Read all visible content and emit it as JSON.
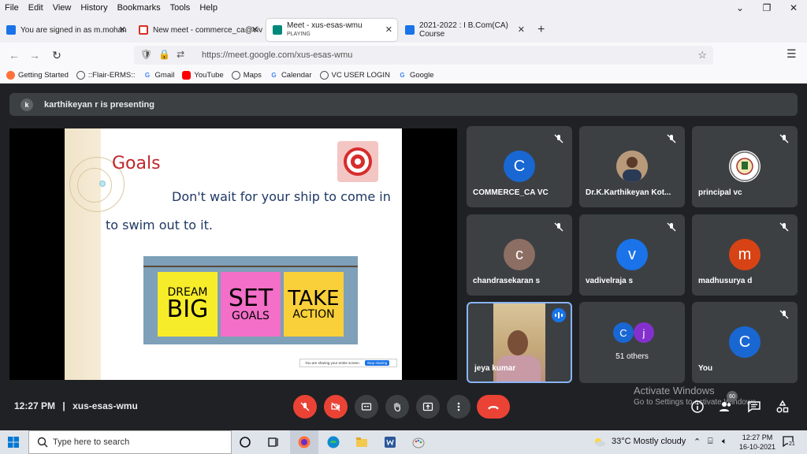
{
  "menubar": {
    "items": [
      "File",
      "Edit",
      "View",
      "History",
      "Bookmarks",
      "Tools",
      "Help"
    ],
    "minimize": "⌄",
    "restore": "❐",
    "close": "✕"
  },
  "tabs": [
    {
      "title": "You are signed in as m.mohan",
      "color": "#1a73e8"
    },
    {
      "title": "New meet - commerce_ca@viv",
      "color": "#d93025"
    },
    {
      "title": "Meet - xus-esas-wmu",
      "subtitle": "PLAYING",
      "color": "#00897b"
    },
    {
      "title": "2021-2022 : I B.Com(CA) Course",
      "color": "#1a73e8"
    }
  ],
  "navbar": {
    "url": "https://meet.google.com/xus-esas-wmu",
    "url_domain": "meet.google.com"
  },
  "bookmarks": [
    {
      "label": "Getting Started",
      "icon": "firefox-icon"
    },
    {
      "label": "::Flair-ERMS::",
      "icon": "globe-icon"
    },
    {
      "label": "Gmail",
      "icon": "google-icon"
    },
    {
      "label": "YouTube",
      "icon": "youtube-icon"
    },
    {
      "label": "Maps",
      "icon": "globe-icon"
    },
    {
      "label": "Calendar",
      "icon": "google-icon"
    },
    {
      "label": "VC USER LOGIN",
      "icon": "globe-icon"
    },
    {
      "label": "Google",
      "icon": "google-icon"
    }
  ],
  "presenter": {
    "avatar_letter": "k",
    "text": "karthikeyan r is presenting"
  },
  "slide": {
    "title": "Goals",
    "quote_line1": "Don't wait for your ship to come in",
    "quote_line2": "to swim out to it.",
    "notes": [
      {
        "line1": "DREAM",
        "line2": "BIG",
        "color": "#f7ec2a"
      },
      {
        "line1": "SET",
        "line2": "GOALS",
        "color": "#f36fc8"
      },
      {
        "line1": "TAKE",
        "line2": "ACTION",
        "color": "#f9d03a"
      }
    ],
    "sharing_text": "You are sharing your entire screen.",
    "stop_sharing": "Stop sharing"
  },
  "participants": [
    {
      "name": "COMMERCE_CA VC",
      "letter": "C",
      "color": "#1967d2"
    },
    {
      "name": "Dr.K.Karthikeyan Kot...",
      "letter": "",
      "color": "#8d6e63"
    },
    {
      "name": "principal vc",
      "letter": "",
      "color": "#ffffff"
    },
    {
      "name": "chandrasekaran s",
      "letter": "c",
      "color": "#8d6e63"
    },
    {
      "name": "vadivelraja s",
      "letter": "v",
      "color": "#1a73e8"
    },
    {
      "name": "madhusurya d",
      "letter": "m",
      "color": "#d84315"
    },
    {
      "name": "jeya kumar",
      "letter": "",
      "color": ""
    },
    {
      "name": "51 others",
      "letter": "",
      "color": ""
    },
    {
      "name": "You",
      "letter": "C",
      "color": "#1967d2"
    }
  ],
  "others_avatars": [
    {
      "letter": "C",
      "color": "#1967d2"
    },
    {
      "letter": "j",
      "color": "#8430ce"
    }
  ],
  "meeting": {
    "time": "12:27 PM",
    "separator": "|",
    "code": "xus-esas-wmu",
    "participant_count": "60"
  },
  "watermark": {
    "line1": "Activate Windows",
    "line2": "Go to Settings to activate Windows."
  },
  "taskbar": {
    "search_placeholder": "Type here to search",
    "weather": "33°C  Mostly cloudy",
    "time": "12:27 PM",
    "date": "16-10-2021",
    "notifications": "21"
  },
  "colors": {
    "meet_bg": "#202124",
    "tile_bg": "#3c4043",
    "hangup": "#ea4335",
    "speaking": "#8ab4f8"
  }
}
